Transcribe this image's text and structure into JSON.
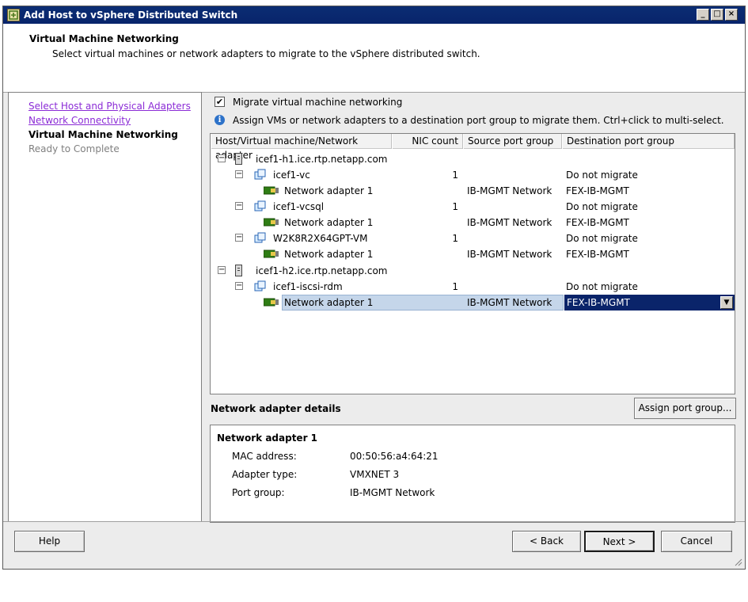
{
  "window": {
    "title": "Add Host to vSphere Distributed Switch",
    "controls": {
      "minimize": "_",
      "maximize": "□",
      "close": "×"
    }
  },
  "header": {
    "title": "Virtual Machine Networking",
    "subtitle": "Select virtual machines or network adapters to migrate to the vSphere distributed switch."
  },
  "nav": {
    "items": [
      {
        "label": "Select Host and Physical Adapters",
        "state": "link"
      },
      {
        "label": "Network Connectivity",
        "state": "link"
      },
      {
        "label": "Virtual Machine Networking",
        "state": "current"
      },
      {
        "label": "Ready to Complete",
        "state": "disabled"
      }
    ]
  },
  "main": {
    "migrate_checkbox": {
      "label": "Migrate virtual machine networking",
      "checked": true,
      "mark": "✔"
    },
    "info_text": "Assign VMs or network adapters to a destination port group to migrate them. Ctrl+click to multi-select.",
    "table": {
      "columns": [
        "Host/Virtual machine/Network adapter",
        "NIC count",
        "Source port group",
        "Destination port group"
      ],
      "rows": [
        {
          "type": "host",
          "name": "icef1-h1.ice.rtp.netapp.com",
          "nic_count": "",
          "source": "",
          "destination": ""
        },
        {
          "type": "vm",
          "name": "icef1-vc",
          "nic_count": "1",
          "source": "",
          "destination": "Do not migrate"
        },
        {
          "type": "nic",
          "name": "Network adapter 1",
          "nic_count": "",
          "source": "IB-MGMT Network",
          "destination": "FEX-IB-MGMT"
        },
        {
          "type": "vm",
          "name": "icef1-vcsql",
          "nic_count": "1",
          "source": "",
          "destination": "Do not migrate"
        },
        {
          "type": "nic",
          "name": "Network adapter 1",
          "nic_count": "",
          "source": "IB-MGMT Network",
          "destination": "FEX-IB-MGMT"
        },
        {
          "type": "vm",
          "name": "W2K8R2X64GPT-VM",
          "nic_count": "1",
          "source": "",
          "destination": "Do not migrate"
        },
        {
          "type": "nic",
          "name": "Network adapter 1",
          "nic_count": "",
          "source": "IB-MGMT Network",
          "destination": "FEX-IB-MGMT"
        },
        {
          "type": "host",
          "name": "icef1-h2.ice.rtp.netapp.com",
          "nic_count": "",
          "source": "",
          "destination": ""
        },
        {
          "type": "vm",
          "name": "icef1-iscsi-rdm",
          "nic_count": "1",
          "source": "",
          "destination": "Do not migrate"
        },
        {
          "type": "nic",
          "name": "Network adapter 1",
          "nic_count": "",
          "source": "IB-MGMT Network",
          "destination": "FEX-IB-MGMT",
          "selected": true
        }
      ],
      "expander_glyph": "−",
      "combo_arrow": "▼"
    },
    "details": {
      "heading": "Network adapter details",
      "assign_button": "Assign port group...",
      "title": "Network adapter 1",
      "fields": [
        {
          "label": "MAC address:",
          "value": "00:50:56:a4:64:21"
        },
        {
          "label": "Adapter type:",
          "value": "VMXNET 3"
        },
        {
          "label": "Port group:",
          "value": "IB-MGMT Network"
        }
      ]
    }
  },
  "footer": {
    "help": "Help",
    "back": "< Back",
    "next": "Next >",
    "cancel": "Cancel"
  },
  "icons": {
    "title": "vsphere-switch-icon",
    "info": "info-icon",
    "host": "server-host-icon",
    "vm": "virtual-machine-icon",
    "nic": "network-adapter-icon"
  },
  "colors": {
    "titlebar": "#0a246a",
    "link": "#8b2bd6",
    "selection": "#0a246a",
    "row_highlight": "#c5d6ea"
  }
}
